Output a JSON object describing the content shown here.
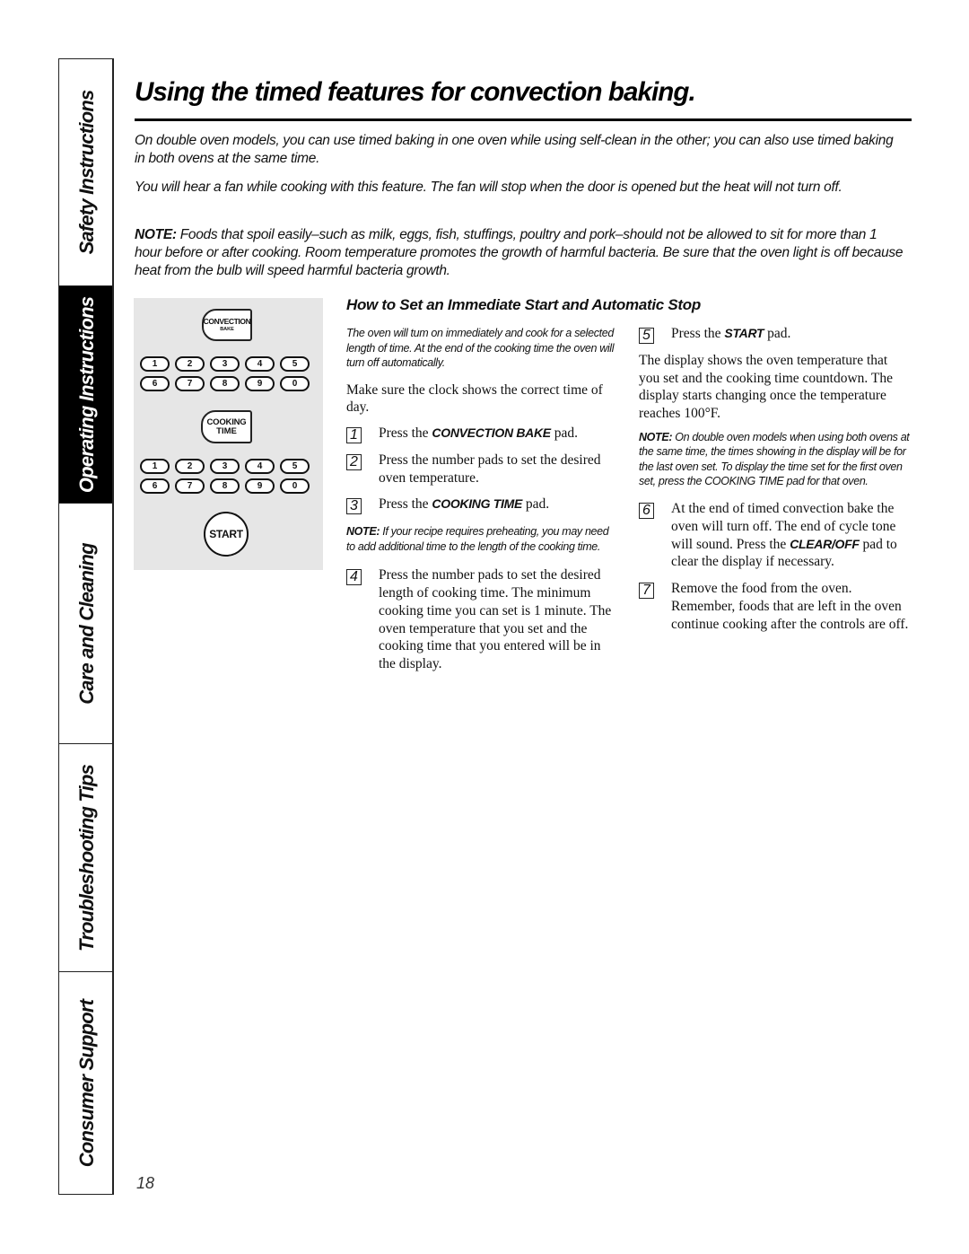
{
  "sidebar": {
    "tabs": [
      {
        "label": "Safety Instructions",
        "active": false
      },
      {
        "label": "Operating Instructions",
        "active": true
      },
      {
        "label": "Care and Cleaning",
        "active": false
      },
      {
        "label": "Troubleshooting Tips",
        "active": false
      },
      {
        "label": "Consumer Support",
        "active": false
      }
    ]
  },
  "page": {
    "title": "Using the timed features for convection baking.",
    "intro_1": "On double oven models, you can use timed baking in one oven while using self-clean in the other; you can also use timed baking in both ovens at the same time.",
    "intro_2": "You will hear a fan while cooking with this feature. The fan will stop when the door is opened but the heat will not turn off.",
    "note_label": "NOTE:",
    "note_text": " Foods that spoil easily–such as milk, eggs, fish, stuffings, poultry and pork–should not be allowed to sit for more than 1 hour before or after cooking. Room temperature promotes the growth of harmful bacteria. Be sure that the oven light is off because heat from the bulb will speed harmful bacteria growth.",
    "page_number": "18"
  },
  "keypad": {
    "convection_pad": {
      "line1": "CONVECTION",
      "line2": "BAKE"
    },
    "cooking_time_pad": {
      "line1": "COOKING",
      "line2": "TIME"
    },
    "numbers": [
      "1",
      "2",
      "3",
      "4",
      "5",
      "6",
      "7",
      "8",
      "9",
      "0"
    ],
    "start_label": "START"
  },
  "section": {
    "heading": "How to Set an Immediate Start and Automatic Stop",
    "lead": "The oven will tum on immediately and cook for a selected length of time. At the end of the cooking time the oven will turn off automatically.",
    "clock_note": "Make sure the clock shows the correct time of day.",
    "steps": [
      {
        "num": "1",
        "pre": "Press the ",
        "kw": "CONVECTION BAKE",
        "post": " pad."
      },
      {
        "num": "2",
        "pre": "Press the number pads to set the desired oven temperature.",
        "kw": "",
        "post": ""
      },
      {
        "num": "3",
        "pre": "Press the ",
        "kw": "COOKING TIME",
        "post": " pad."
      },
      {
        "num": "4",
        "pre": "Press the number pads to set the desired length of cooking time. The minimum cooking time you can set is 1 minute. The oven temperature that you set and the cooking time that you entered will be in the display.",
        "kw": "",
        "post": ""
      },
      {
        "num": "5",
        "pre": "Press the ",
        "kw": "START",
        "post": " pad."
      },
      {
        "num": "6",
        "pre": "At the end of timed convection bake the oven will turn off. The end of cycle tone will sound. Press the ",
        "kw": "CLEAR/OFF",
        "post": " pad to clear the display if necessary."
      },
      {
        "num": "7",
        "pre": "Remove the food from the oven. Remember, foods that are left in the oven continue cooking after the controls are off.",
        "kw": "",
        "post": ""
      }
    ],
    "preheat_note_label": "NOTE:",
    "preheat_note_text": " If your recipe requires preheating, you may need to add additional time to the length of the cooking time.",
    "display_text": "The display shows the oven temperature that you set and the cooking time countdown. The display starts changing once the temperature reaches 100°F.",
    "double_note_label": "NOTE:",
    "double_note_text": " On double oven models when using both ovens at the same time, the times showing in the display will be for the last oven set. To display the time set for the first oven set, press the COOKING TIME pad for that oven."
  }
}
